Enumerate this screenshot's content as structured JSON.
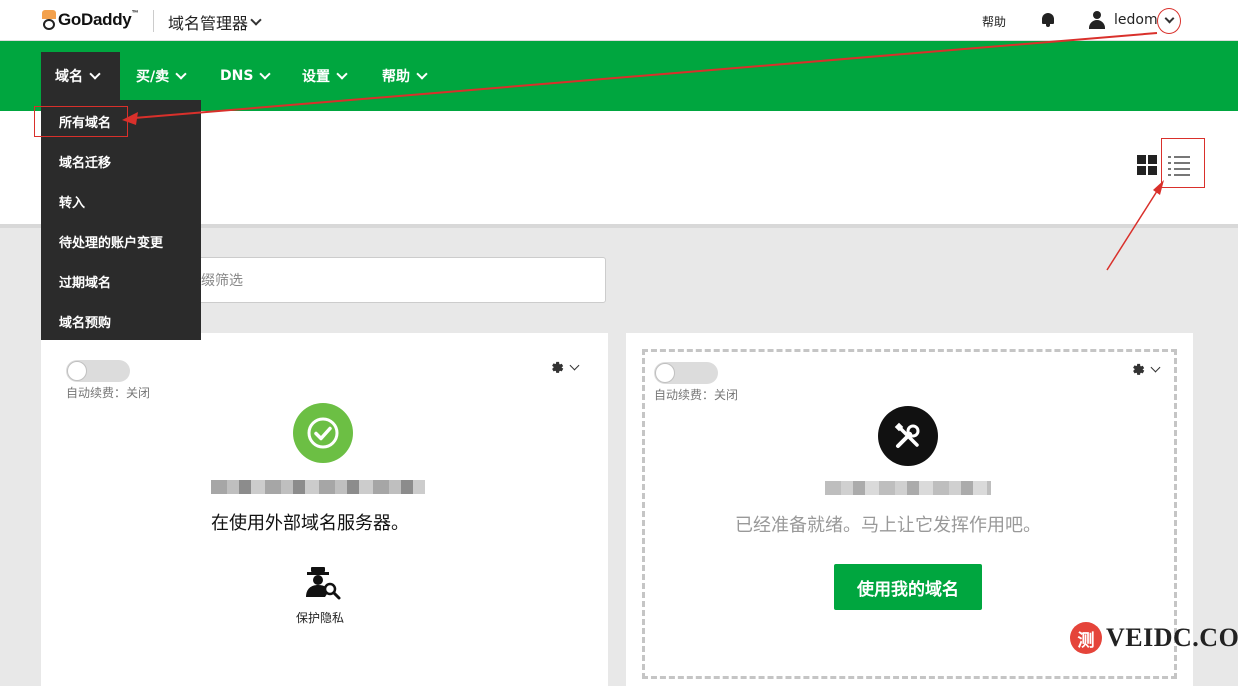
{
  "topbar": {
    "logo_text": "GoDaddy",
    "logo_tm": "™",
    "app_title": "域名管理器",
    "help": "帮助",
    "user_name": "ledom"
  },
  "nav": {
    "items": [
      {
        "label": "域名"
      },
      {
        "label": "买/卖"
      },
      {
        "label": "DNS"
      },
      {
        "label": "设置"
      },
      {
        "label": "帮助"
      }
    ]
  },
  "dropdown": {
    "items": [
      {
        "label": "所有域名"
      },
      {
        "label": "域名迁移"
      },
      {
        "label": "转入"
      },
      {
        "label": "待处理的账户变更"
      },
      {
        "label": "过期域名"
      },
      {
        "label": "域名预购"
      }
    ]
  },
  "filter": {
    "placeholder_visible": "缀筛选"
  },
  "cards": [
    {
      "auto_renew": "自动续费：关闭",
      "status_text": "在使用外部域名服务器。",
      "privacy_label": "保护隐私"
    },
    {
      "auto_renew": "自动续费：关闭",
      "status_text": "已经准备就绪。马上让它发挥作用吧。",
      "button_label": "使用我的域名"
    }
  ],
  "watermark": {
    "circle_char": "测",
    "text": "VEIDC.COM"
  },
  "colors": {
    "brand_green": "#00a63f",
    "dark_menu": "#2b2b2b",
    "annotation_red": "#d9302b",
    "status_green": "#6cbf44"
  }
}
